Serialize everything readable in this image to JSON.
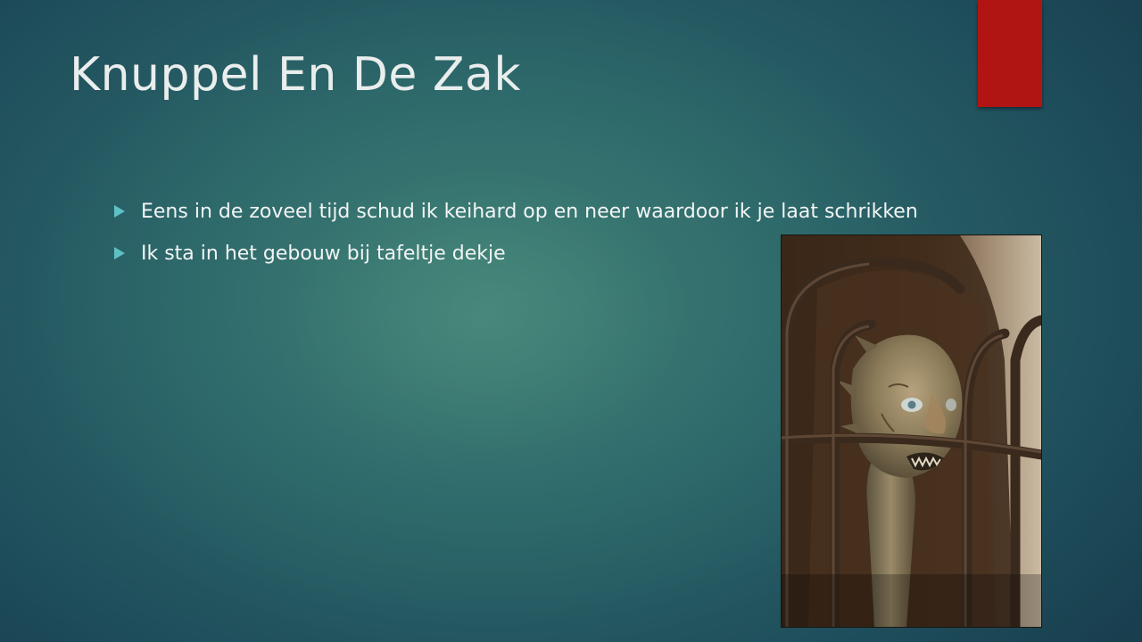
{
  "slide": {
    "title": "Knuppel En De Zak",
    "accent_color": "#b01513",
    "bullet_icon": "triangle-right-icon",
    "bullet_color": "#5ec1c6",
    "bullets": [
      {
        "text": "Eens in de zoveel tijd schud ik keihard op en neer waardoor ik je laat schrikken"
      },
      {
        "text": "Ik sta in het gebouw bij tafeltje dekje"
      }
    ]
  },
  "photo": {
    "subject": "carved-face-behind-iron-bars"
  }
}
